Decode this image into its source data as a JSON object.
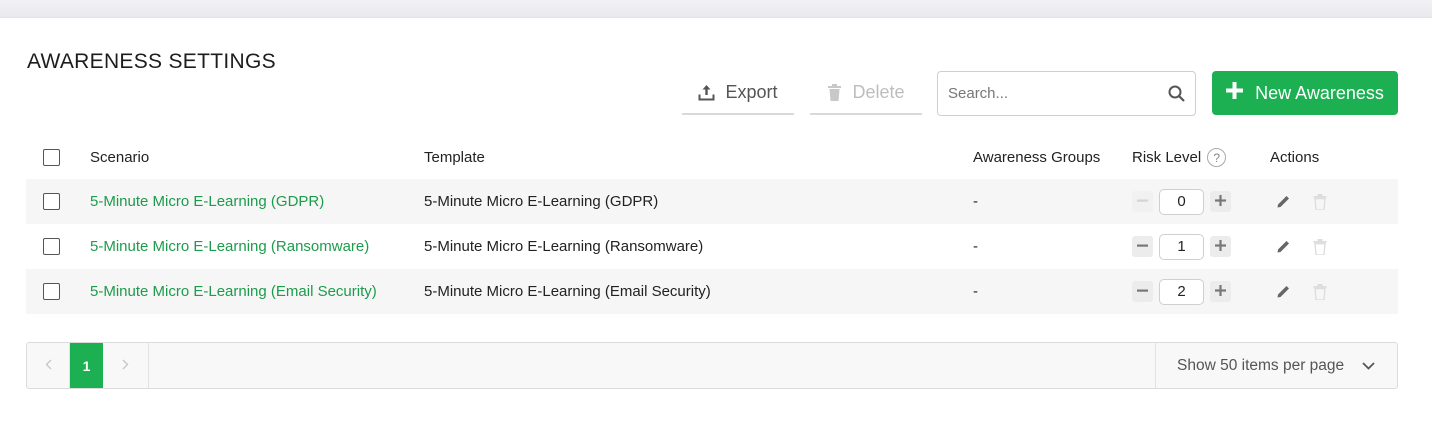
{
  "page": {
    "title": "AWARENESS SETTINGS"
  },
  "toolbar": {
    "export_label": "Export",
    "delete_label": "Delete",
    "search_placeholder": "Search...",
    "new_label": "New Awareness"
  },
  "table": {
    "headers": {
      "scenario": "Scenario",
      "template": "Template",
      "groups": "Awareness Groups",
      "risk": "Risk Level",
      "risk_help": "?",
      "actions": "Actions"
    },
    "rows": [
      {
        "scenario": "5-Minute Micro E-Learning (GDPR)",
        "template": "5-Minute Micro E-Learning (GDPR)",
        "groups": "-",
        "risk": "0"
      },
      {
        "scenario": "5-Minute Micro E-Learning (Ransomware)",
        "template": "5-Minute Micro E-Learning (Ransomware)",
        "groups": "-",
        "risk": "1"
      },
      {
        "scenario": "5-Minute Micro E-Learning (Email Security)",
        "template": "5-Minute Micro E-Learning (Email Security)",
        "groups": "-",
        "risk": "2"
      }
    ]
  },
  "pagination": {
    "current_page": "1",
    "per_page_label": "Show 50 items per page"
  },
  "colors": {
    "accent": "#1db053",
    "link": "#1c9c4b"
  },
  "icons": [
    "upload-icon",
    "trash-icon",
    "search-icon",
    "plus-icon",
    "help-icon",
    "minus-icon",
    "pencil-icon",
    "chevron-left-icon",
    "chevron-right-icon",
    "chevron-down-icon"
  ]
}
